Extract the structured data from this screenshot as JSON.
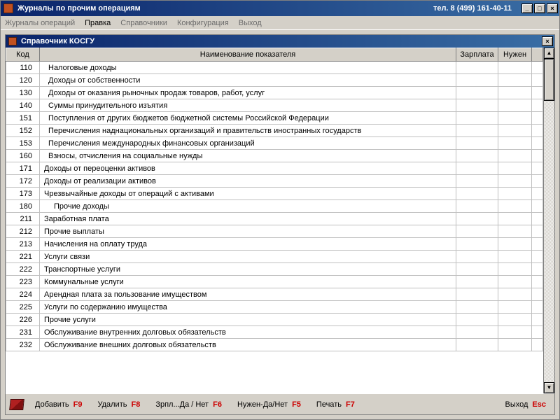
{
  "window": {
    "title_left": "Журналы по прочим операциям",
    "title_right": "тел. 8 (499) 161-40-11"
  },
  "menu": {
    "items": [
      {
        "label": "Журналы операций"
      },
      {
        "label": "Правка"
      },
      {
        "label": "Справочники"
      },
      {
        "label": "Конфигурация"
      },
      {
        "label": "Выход"
      }
    ],
    "active_index": 1
  },
  "child": {
    "title": "Справочник КОСГУ"
  },
  "columns": {
    "code": "Код",
    "name": "Наименование показателя",
    "salary": "Зарплата",
    "need": "Нужен"
  },
  "rows": [
    {
      "code": "110",
      "name": "Налоговые доходы",
      "indent": 1
    },
    {
      "code": "120",
      "name": "Доходы от собственности",
      "indent": 1
    },
    {
      "code": "130",
      "name": "Доходы от оказания рыночных продаж товаров, работ, услуг",
      "indent": 1
    },
    {
      "code": "140",
      "name": "Суммы принудительного изъятия",
      "indent": 1
    },
    {
      "code": "151",
      "name": "Поступления от других бюджетов бюджетной системы Российской Федерации",
      "indent": 1
    },
    {
      "code": "152",
      "name": "Перечисления наднациональных организаций и правительств иностранных государств",
      "indent": 1
    },
    {
      "code": "153",
      "name": "Перечисления международных финансовых организаций",
      "indent": 1
    },
    {
      "code": "160",
      "name": "Взносы, отчисления на социальные нужды",
      "indent": 1
    },
    {
      "code": "171",
      "name": "Доходы от переоценки активов",
      "indent": 0
    },
    {
      "code": "172",
      "name": "Доходы от реализации активов",
      "indent": 0
    },
    {
      "code": "173",
      "name": "Чрезвычайные доходы от операций с активами",
      "indent": 0
    },
    {
      "code": "180",
      "name": "Прочие доходы",
      "indent": 2
    },
    {
      "code": "211",
      "name": "Заработная плата",
      "indent": 0
    },
    {
      "code": "212",
      "name": "Прочие выплаты",
      "indent": 0
    },
    {
      "code": "213",
      "name": "Начисления на оплату труда",
      "indent": 0
    },
    {
      "code": "221",
      "name": "Услуги связи",
      "indent": 0
    },
    {
      "code": "222",
      "name": "Транспортные услуги",
      "indent": 0
    },
    {
      "code": "223",
      "name": "Коммунальные услуги",
      "indent": 0
    },
    {
      "code": "224",
      "name": "Арендная плата за пользование имуществом",
      "indent": 0
    },
    {
      "code": "225",
      "name": "Услуги по содержанию имущества",
      "indent": 0
    },
    {
      "code": "226",
      "name": "Прочие услуги",
      "indent": 0
    },
    {
      "code": "231",
      "name": "Обслуживание внутренних долговых обязательств",
      "indent": 0
    },
    {
      "code": "232",
      "name": "Обслуживание внешних долговых обязательств",
      "indent": 0
    }
  ],
  "actions": {
    "add": {
      "label": "Добавить",
      "key": "F9"
    },
    "del": {
      "label": "Удалить",
      "key": "F8"
    },
    "sal": {
      "label": "Зрпл...Да / Нет",
      "key": "F6"
    },
    "need": {
      "label": "Нужен-Да/Нет",
      "key": "F5"
    },
    "print": {
      "label": "Печать",
      "key": "F7"
    },
    "exit": {
      "label": "Выход",
      "key": "Esc"
    }
  }
}
